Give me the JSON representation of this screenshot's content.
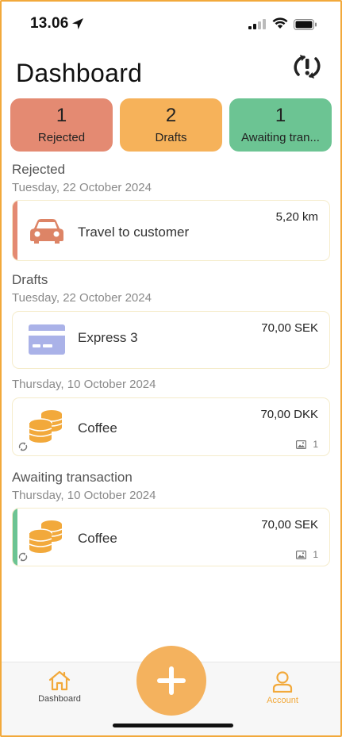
{
  "status_bar": {
    "time": "13.06"
  },
  "header": {
    "title": "Dashboard"
  },
  "tiles": [
    {
      "count": "1",
      "label": "Rejected",
      "color": "#e48a72"
    },
    {
      "count": "2",
      "label": "Drafts",
      "color": "#f6b25a"
    },
    {
      "count": "1",
      "label": "Awaiting tran...",
      "color": "#6cc493"
    }
  ],
  "sections": {
    "rejected": {
      "title": "Rejected",
      "date": "Tuesday, 22 October 2024",
      "items": [
        {
          "name": "Travel to customer",
          "amount": "5,20 km",
          "icon": "car-icon",
          "stripe_color": "#e48a72"
        }
      ]
    },
    "drafts": {
      "title": "Drafts",
      "groups": [
        {
          "date": "Tuesday, 22 October 2024",
          "items": [
            {
              "name": "Express 3",
              "amount": "70,00  SEK",
              "icon": "credit-card-icon"
            }
          ]
        },
        {
          "date": "Thursday, 10 October 2024",
          "items": [
            {
              "name": "Coffee",
              "amount": "70,00  DKK",
              "icon": "coins-icon",
              "attachments": "1"
            }
          ]
        }
      ]
    },
    "awaiting": {
      "title": "Awaiting transaction",
      "date": "Thursday, 10 October 2024",
      "items": [
        {
          "name": "Coffee",
          "amount": "70,00  SEK",
          "icon": "coins-icon",
          "attachments": "1",
          "stripe_color": "#6cc493"
        }
      ]
    }
  },
  "tabbar": {
    "dashboard_label": "Dashboard",
    "account_label": "Account",
    "add_icon": "plus-icon",
    "accent": "#f2a93b"
  }
}
